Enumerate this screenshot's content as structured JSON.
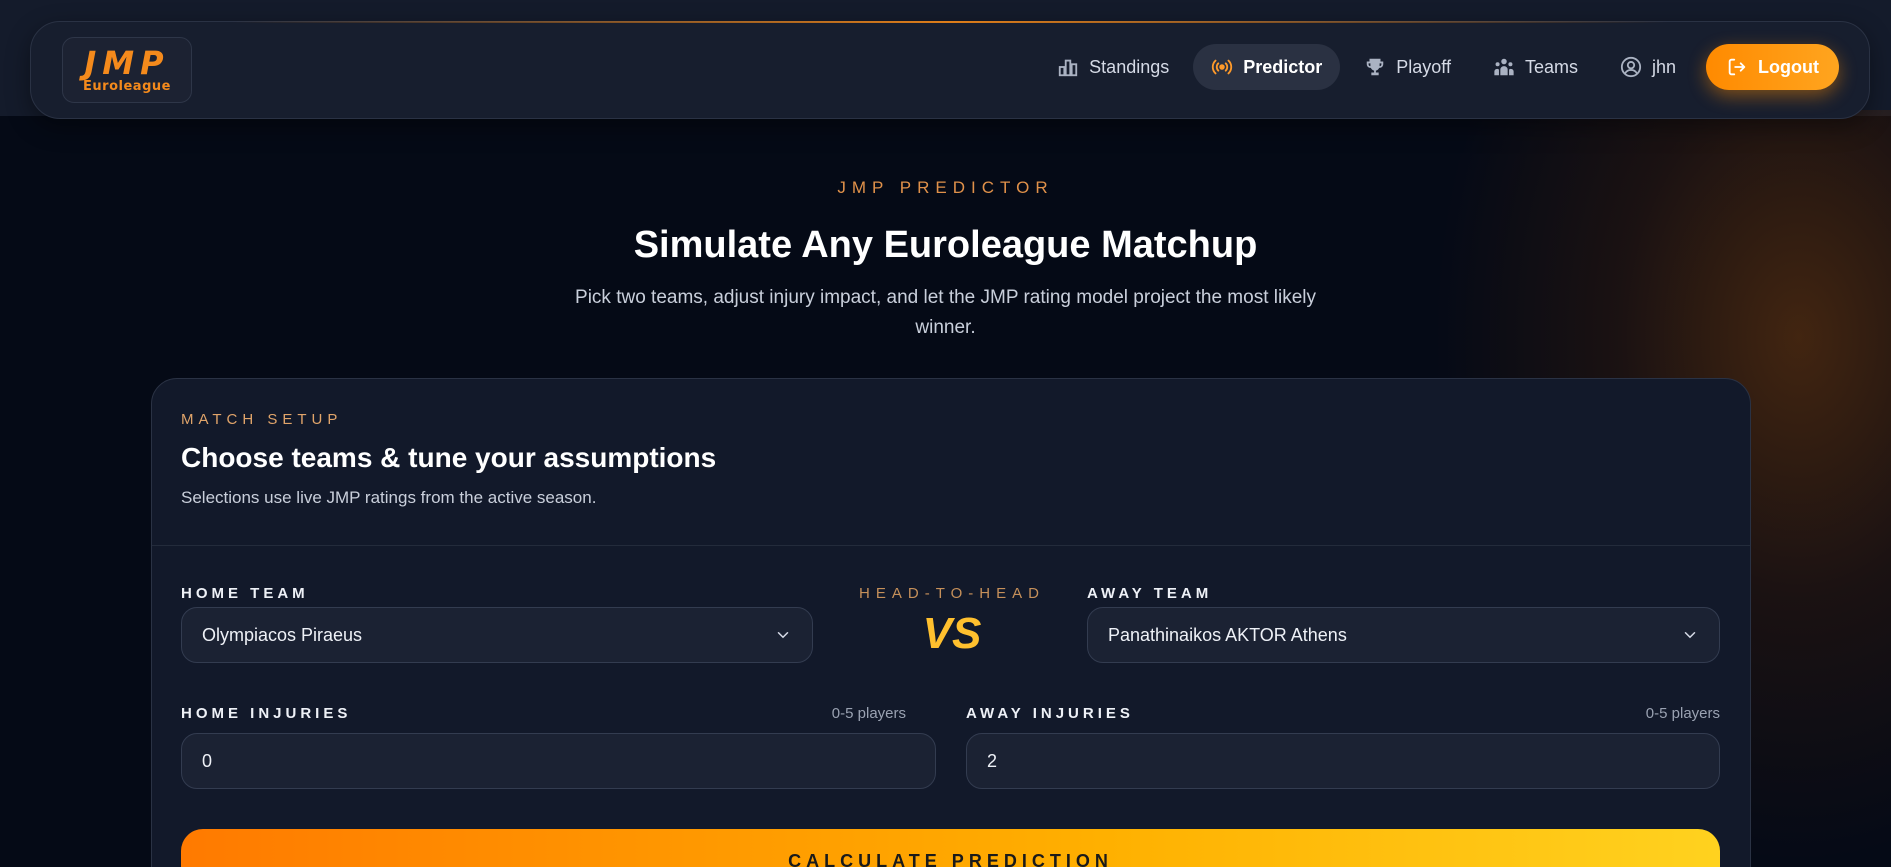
{
  "brand": {
    "logo_main": "JMP",
    "logo_sub": "Euroleague"
  },
  "nav": {
    "items": [
      {
        "label": "Standings",
        "icon": "standings-icon",
        "active": false
      },
      {
        "label": "Predictor",
        "icon": "broadcast-icon",
        "active": true
      },
      {
        "label": "Playoff",
        "icon": "trophy-icon",
        "active": false
      },
      {
        "label": "Teams",
        "icon": "teams-icon",
        "active": false
      },
      {
        "label": "jhn",
        "icon": "user-icon",
        "active": false
      }
    ],
    "logout_label": "Logout"
  },
  "hero": {
    "eyebrow": "JMP PREDICTOR",
    "title": "Simulate Any Euroleague Matchup",
    "subtitle": "Pick two teams, adjust injury impact, and let the JMP rating model project the most likely winner."
  },
  "setup": {
    "eyebrow": "MATCH SETUP",
    "title": "Choose teams & tune your assumptions",
    "subtitle": "Selections use live JMP ratings from the active season.",
    "home_team_label": "HOME TEAM",
    "home_team_value": "Olympiacos Piraeus",
    "away_team_label": "AWAY TEAM",
    "away_team_value": "Panathinaikos AKTOR Athens",
    "h2h_label": "HEAD-TO-HEAD",
    "vs_label": "VS",
    "home_injuries_label": "HOME INJURIES",
    "home_injuries_hint": "0-5 players",
    "home_injuries_value": "0",
    "away_injuries_label": "AWAY INJURIES",
    "away_injuries_hint": "0-5 players",
    "away_injuries_value": "2",
    "calculate_label": "CALCULATE PREDICTION"
  },
  "colors": {
    "accent": "#ff8a00",
    "background": "#050a16",
    "card": "#12192a"
  }
}
